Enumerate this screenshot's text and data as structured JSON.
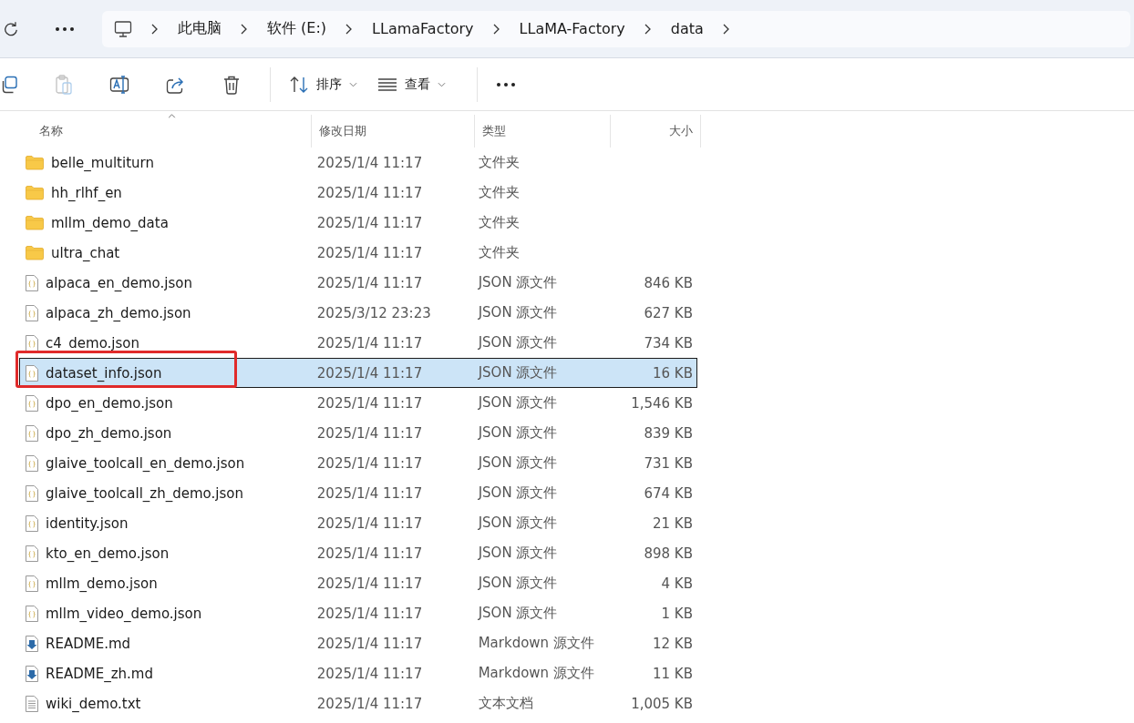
{
  "address_bar": {
    "crumbs": [
      "此电脑",
      "软件 (E:)",
      "LLamaFactory",
      "LLaMA-Factory",
      "data"
    ]
  },
  "toolbar": {
    "sort_label": "排序",
    "view_label": "查看",
    "paste_disabled": true
  },
  "table": {
    "columns": [
      "名称",
      "修改日期",
      "类型",
      "大小"
    ],
    "rows": [
      {
        "kind": "folder",
        "name": "belle_multiturn",
        "date": "2025/1/4 11:17",
        "type": "文件夹",
        "size": "",
        "selected": false,
        "marked": false
      },
      {
        "kind": "folder",
        "name": "hh_rlhf_en",
        "date": "2025/1/4 11:17",
        "type": "文件夹",
        "size": "",
        "selected": false,
        "marked": false
      },
      {
        "kind": "folder",
        "name": "mllm_demo_data",
        "date": "2025/1/4 11:17",
        "type": "文件夹",
        "size": "",
        "selected": false,
        "marked": false
      },
      {
        "kind": "folder",
        "name": "ultra_chat",
        "date": "2025/1/4 11:17",
        "type": "文件夹",
        "size": "",
        "selected": false,
        "marked": false
      },
      {
        "kind": "json",
        "name": "alpaca_en_demo.json",
        "date": "2025/1/4 11:17",
        "type": "JSON 源文件",
        "size": "846 KB",
        "selected": false,
        "marked": false
      },
      {
        "kind": "json",
        "name": "alpaca_zh_demo.json",
        "date": "2025/3/12 23:23",
        "type": "JSON 源文件",
        "size": "627 KB",
        "selected": false,
        "marked": false
      },
      {
        "kind": "json",
        "name": "c4_demo.json",
        "date": "2025/1/4 11:17",
        "type": "JSON 源文件",
        "size": "734 KB",
        "selected": false,
        "marked": false
      },
      {
        "kind": "json",
        "name": "dataset_info.json",
        "date": "2025/1/4 11:17",
        "type": "JSON 源文件",
        "size": "16 KB",
        "selected": true,
        "marked": true
      },
      {
        "kind": "json",
        "name": "dpo_en_demo.json",
        "date": "2025/1/4 11:17",
        "type": "JSON 源文件",
        "size": "1,546 KB",
        "selected": false,
        "marked": false
      },
      {
        "kind": "json",
        "name": "dpo_zh_demo.json",
        "date": "2025/1/4 11:17",
        "type": "JSON 源文件",
        "size": "839 KB",
        "selected": false,
        "marked": false
      },
      {
        "kind": "json",
        "name": "glaive_toolcall_en_demo.json",
        "date": "2025/1/4 11:17",
        "type": "JSON 源文件",
        "size": "731 KB",
        "selected": false,
        "marked": false
      },
      {
        "kind": "json",
        "name": "glaive_toolcall_zh_demo.json",
        "date": "2025/1/4 11:17",
        "type": "JSON 源文件",
        "size": "674 KB",
        "selected": false,
        "marked": false
      },
      {
        "kind": "json",
        "name": "identity.json",
        "date": "2025/1/4 11:17",
        "type": "JSON 源文件",
        "size": "21 KB",
        "selected": false,
        "marked": false
      },
      {
        "kind": "json",
        "name": "kto_en_demo.json",
        "date": "2025/1/4 11:17",
        "type": "JSON 源文件",
        "size": "898 KB",
        "selected": false,
        "marked": false
      },
      {
        "kind": "json",
        "name": "mllm_demo.json",
        "date": "2025/1/4 11:17",
        "type": "JSON 源文件",
        "size": "4 KB",
        "selected": false,
        "marked": false
      },
      {
        "kind": "json",
        "name": "mllm_video_demo.json",
        "date": "2025/1/4 11:17",
        "type": "JSON 源文件",
        "size": "1 KB",
        "selected": false,
        "marked": false
      },
      {
        "kind": "markdown",
        "name": "README.md",
        "date": "2025/1/4 11:17",
        "type": "Markdown 源文件",
        "size": "12 KB",
        "selected": false,
        "marked": false
      },
      {
        "kind": "markdown",
        "name": "README_zh.md",
        "date": "2025/1/4 11:17",
        "type": "Markdown 源文件",
        "size": "11 KB",
        "selected": false,
        "marked": false
      },
      {
        "kind": "text",
        "name": "wiki_demo.txt",
        "date": "2025/1/4 11:17",
        "type": "文本文档",
        "size": "1,005 KB",
        "selected": false,
        "marked": false
      }
    ]
  }
}
